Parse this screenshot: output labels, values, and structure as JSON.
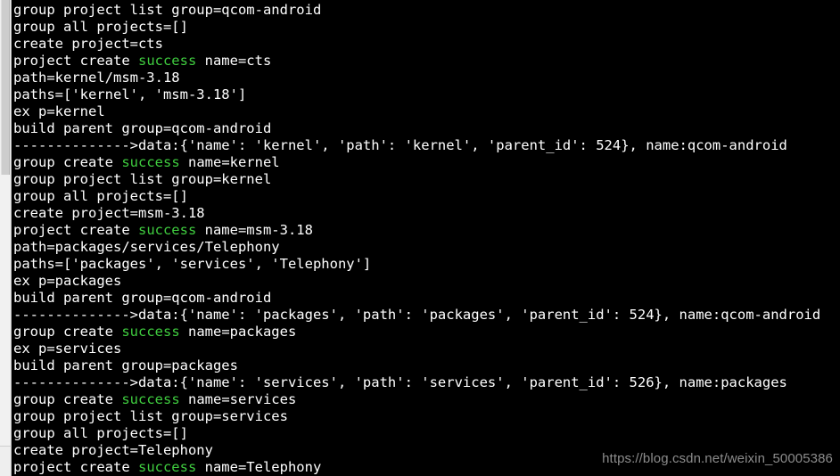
{
  "window": {
    "kind": "terminal-console",
    "background_color": "#000000",
    "text_color": "#ffffff",
    "highlight_color": "#3fcc3f"
  },
  "scrollbar": {
    "position": "left",
    "track_color": "#f1f1f1",
    "thumb_color": "#cdcdcd"
  },
  "watermark": {
    "text": "https://blog.csdn.net/weixin_50005386",
    "color": "#8c8c8c"
  },
  "terminal": {
    "lines": [
      {
        "segments": [
          {
            "text": "group project list group=qcom-android"
          }
        ]
      },
      {
        "segments": [
          {
            "text": "group all projects=[]"
          }
        ]
      },
      {
        "segments": [
          {
            "text": "create project=cts"
          }
        ]
      },
      {
        "segments": [
          {
            "text": "project create "
          },
          {
            "text": "success",
            "style": "success"
          },
          {
            "text": " name=cts"
          }
        ]
      },
      {
        "segments": [
          {
            "text": "path=kernel/msm-3.18"
          }
        ]
      },
      {
        "segments": [
          {
            "text": "paths=['kernel', 'msm-3.18']"
          }
        ]
      },
      {
        "segments": [
          {
            "text": "ex p=kernel"
          }
        ]
      },
      {
        "segments": [
          {
            "text": "build parent group=qcom-android"
          }
        ]
      },
      {
        "segments": [
          {
            "text": "-------------->data:{'name': 'kernel', 'path': 'kernel', 'parent_id': 524}, name:qcom-android"
          }
        ]
      },
      {
        "segments": [
          {
            "text": "group create "
          },
          {
            "text": "success",
            "style": "success"
          },
          {
            "text": " name=kernel"
          }
        ]
      },
      {
        "segments": [
          {
            "text": "group project list group=kernel"
          }
        ]
      },
      {
        "segments": [
          {
            "text": "group all projects=[]"
          }
        ]
      },
      {
        "segments": [
          {
            "text": "create project=msm-3.18"
          }
        ]
      },
      {
        "segments": [
          {
            "text": "project create "
          },
          {
            "text": "success",
            "style": "success"
          },
          {
            "text": " name=msm-3.18"
          }
        ]
      },
      {
        "segments": [
          {
            "text": "path=packages/services/Telephony"
          }
        ]
      },
      {
        "segments": [
          {
            "text": "paths=['packages', 'services', 'Telephony']"
          }
        ]
      },
      {
        "segments": [
          {
            "text": "ex p=packages"
          }
        ]
      },
      {
        "segments": [
          {
            "text": "build parent group=qcom-android"
          }
        ]
      },
      {
        "segments": [
          {
            "text": "-------------->data:{'name': 'packages', 'path': 'packages', 'parent_id': 524}, name:qcom-android"
          }
        ]
      },
      {
        "segments": [
          {
            "text": "group create "
          },
          {
            "text": "success",
            "style": "success"
          },
          {
            "text": " name=packages"
          }
        ]
      },
      {
        "segments": [
          {
            "text": "ex p=services"
          }
        ]
      },
      {
        "segments": [
          {
            "text": "build parent group=packages"
          }
        ]
      },
      {
        "segments": [
          {
            "text": "-------------->data:{'name': 'services', 'path': 'services', 'parent_id': 526}, name:packages"
          }
        ]
      },
      {
        "segments": [
          {
            "text": "group create "
          },
          {
            "text": "success",
            "style": "success"
          },
          {
            "text": " name=services"
          }
        ]
      },
      {
        "segments": [
          {
            "text": "group project list group=services"
          }
        ]
      },
      {
        "segments": [
          {
            "text": "group all projects=[]"
          }
        ]
      },
      {
        "segments": [
          {
            "text": "create project=Telephony"
          }
        ]
      },
      {
        "segments": [
          {
            "text": "project create "
          },
          {
            "text": "success",
            "style": "success"
          },
          {
            "text": " name=Telephony"
          }
        ]
      }
    ]
  }
}
